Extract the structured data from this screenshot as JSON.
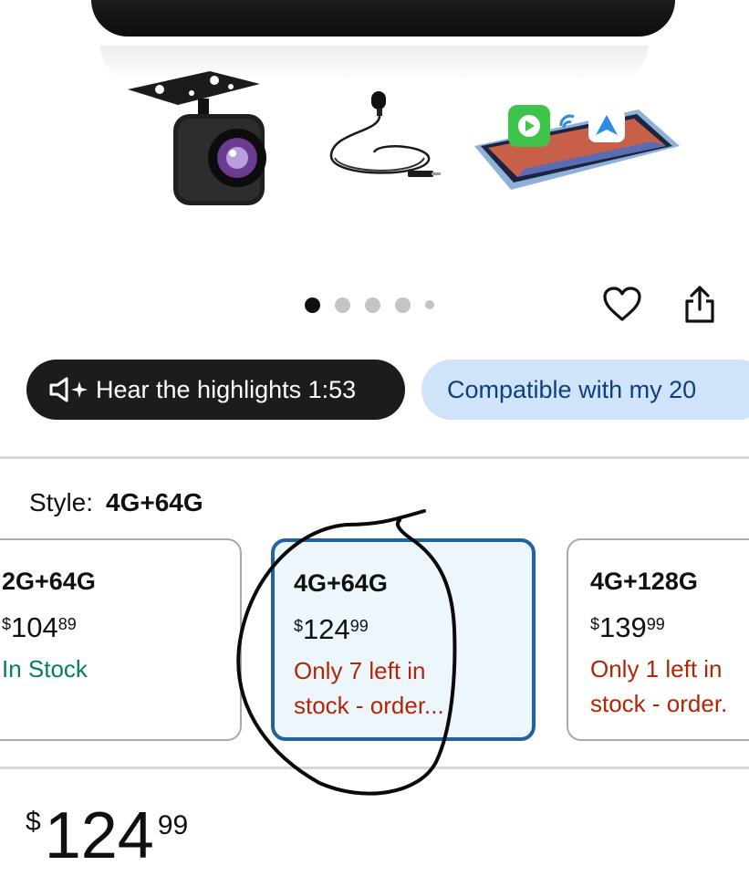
{
  "carousel": {
    "total": 5,
    "active": 0
  },
  "actions": {
    "wishlist_icon": "heart-icon",
    "share_icon": "share-icon"
  },
  "pills": {
    "highlights_label": "Hear the highlights 1:53",
    "highlights_icon": "speaker-sparkle-icon",
    "compat_label": "Compatible with my 20"
  },
  "style": {
    "label": "Style:",
    "selected": "4G+64G",
    "options": [
      {
        "name": "2G+64G",
        "currency": "$",
        "whole": "104",
        "cents": "89",
        "stock_line1": "In Stock",
        "stock_line2": ""
      },
      {
        "name": "4G+64G",
        "currency": "$",
        "whole": "124",
        "cents": "99",
        "stock_line1": "Only 7 left in",
        "stock_line2": "stock - order..."
      },
      {
        "name": "4G+128G",
        "currency": "$",
        "whole": "139",
        "cents": "99",
        "stock_line1": "Only 1 left in",
        "stock_line2": "stock - order."
      }
    ]
  },
  "price": {
    "currency": "$",
    "whole": "124",
    "cents": "99"
  },
  "colors": {
    "accent_blue": "#2162a1",
    "stock_green": "#067d62",
    "stock_red": "#b12704",
    "pill_blue": "#cfe4fb"
  }
}
